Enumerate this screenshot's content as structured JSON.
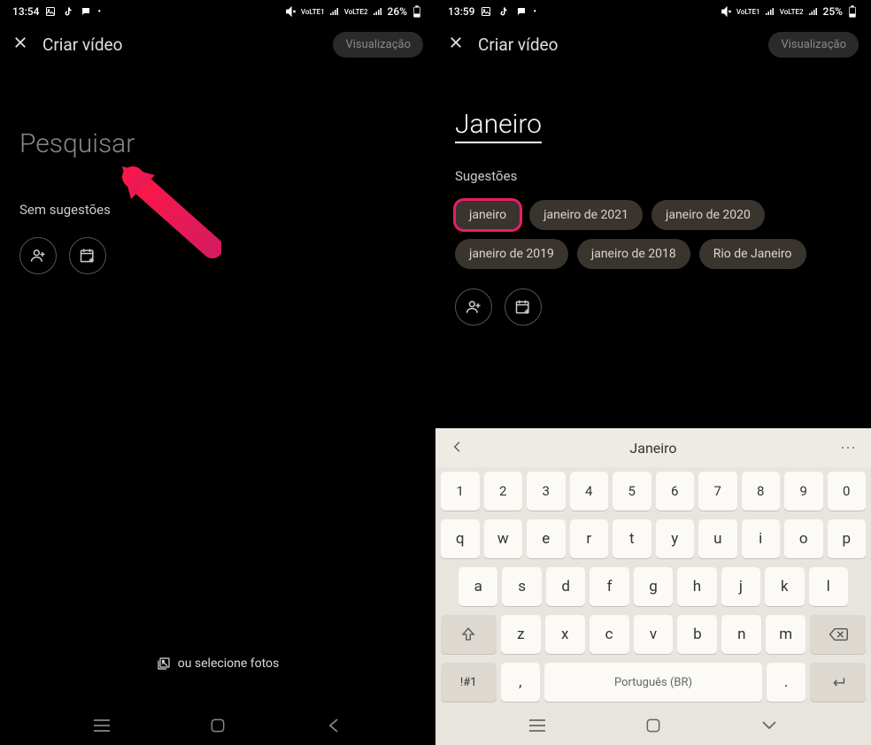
{
  "left": {
    "status": {
      "time": "13:54",
      "battery": "26%",
      "net1": "VoLTE1",
      "net2": "VoLTE2"
    },
    "header": {
      "title": "Criar vídeo",
      "preview": "Visualização"
    },
    "search": {
      "placeholder": "Pesquisar",
      "no_suggestions": "Sem sugestões"
    },
    "bottom": {
      "select_photos": "ou selecione fotos"
    }
  },
  "right": {
    "status": {
      "time": "13:59",
      "battery": "25%",
      "net1": "VoLTE1",
      "net2": "VoLTE2"
    },
    "header": {
      "title": "Criar vídeo",
      "preview": "Visualização"
    },
    "search": {
      "value": "Janeiro",
      "suggestions_label": "Sugestões"
    },
    "chips": [
      "janeiro",
      "janeiro de 2021",
      "janeiro de 2020",
      "janeiro de 2019",
      "janeiro de 2018",
      "Rio de Janeiro"
    ],
    "keyboard": {
      "suggest_word": "Janeiro",
      "row_num": [
        "1",
        "2",
        "3",
        "4",
        "5",
        "6",
        "7",
        "8",
        "9",
        "0"
      ],
      "row1": [
        "q",
        "w",
        "e",
        "r",
        "t",
        "y",
        "u",
        "i",
        "o",
        "p"
      ],
      "row2": [
        "a",
        "s",
        "d",
        "f",
        "g",
        "h",
        "j",
        "k",
        "l"
      ],
      "row3": [
        "z",
        "x",
        "c",
        "v",
        "b",
        "n",
        "m"
      ],
      "symbol": "!#1",
      "comma": ",",
      "space": "Português (BR)",
      "period": "."
    }
  },
  "colors": {
    "highlight": "#e91e63"
  }
}
